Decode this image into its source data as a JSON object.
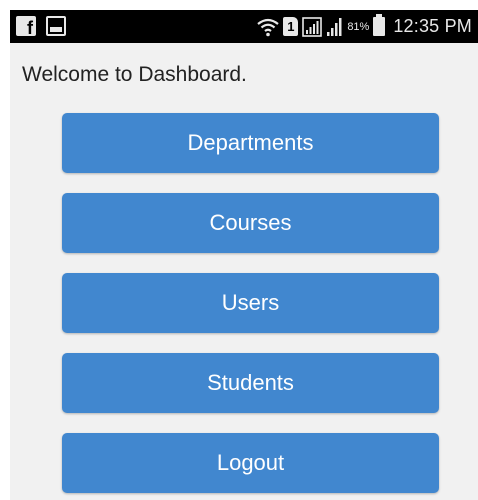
{
  "status_bar": {
    "left_icons": [
      "facebook-icon",
      "message-icon"
    ],
    "right_icons": [
      "wifi-icon",
      "sim-icon",
      "signal-icon",
      "signal-icon",
      "battery-icon"
    ],
    "sim_label": "1",
    "battery_percent": "81%",
    "time": "12:35 PM"
  },
  "colors": {
    "status_bar_bg": "#000000",
    "content_bg": "#f1f1f1",
    "button_bg": "#4187cf",
    "button_text": "#ffffff"
  },
  "dashboard": {
    "welcome_text": "Welcome to Dashboard.",
    "buttons": [
      {
        "label": "Departments"
      },
      {
        "label": "Courses"
      },
      {
        "label": "Users"
      },
      {
        "label": "Students"
      },
      {
        "label": "Logout"
      }
    ]
  }
}
